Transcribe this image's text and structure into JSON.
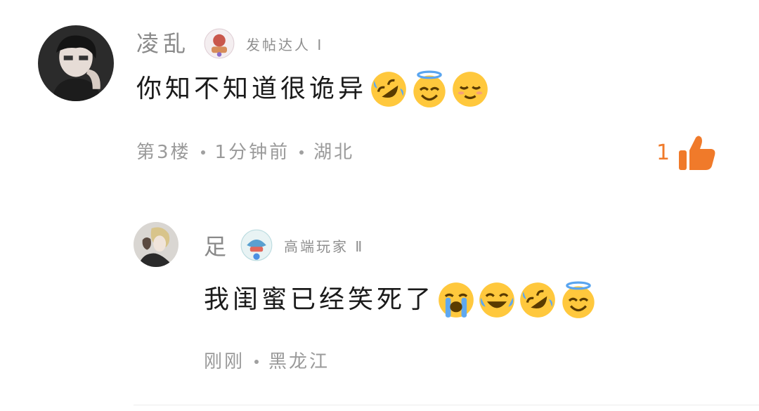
{
  "comments": [
    {
      "username": "凌乱",
      "badge_text": "发帖达人 Ⅰ",
      "text": "你知不知道很诡异",
      "emojis": [
        "rolling-laugh-icon",
        "halo-smile-icon",
        "relieved-face-icon"
      ],
      "floor": "第3楼",
      "time": "1分钟前",
      "location": "湖北",
      "like_count": "1"
    }
  ],
  "replies": [
    {
      "username": "足",
      "badge_text": "高端玩家 Ⅱ",
      "text": "我闺蜜已经笑死了",
      "emojis": [
        "loudly-crying-icon",
        "tears-of-joy-icon",
        "rolling-laugh-icon",
        "halo-smile-icon"
      ],
      "time": "刚刚",
      "location": "黑龙江"
    }
  ],
  "colors": {
    "like_accent": "#f07a2a",
    "meta_gray": "#9a9a9a"
  }
}
